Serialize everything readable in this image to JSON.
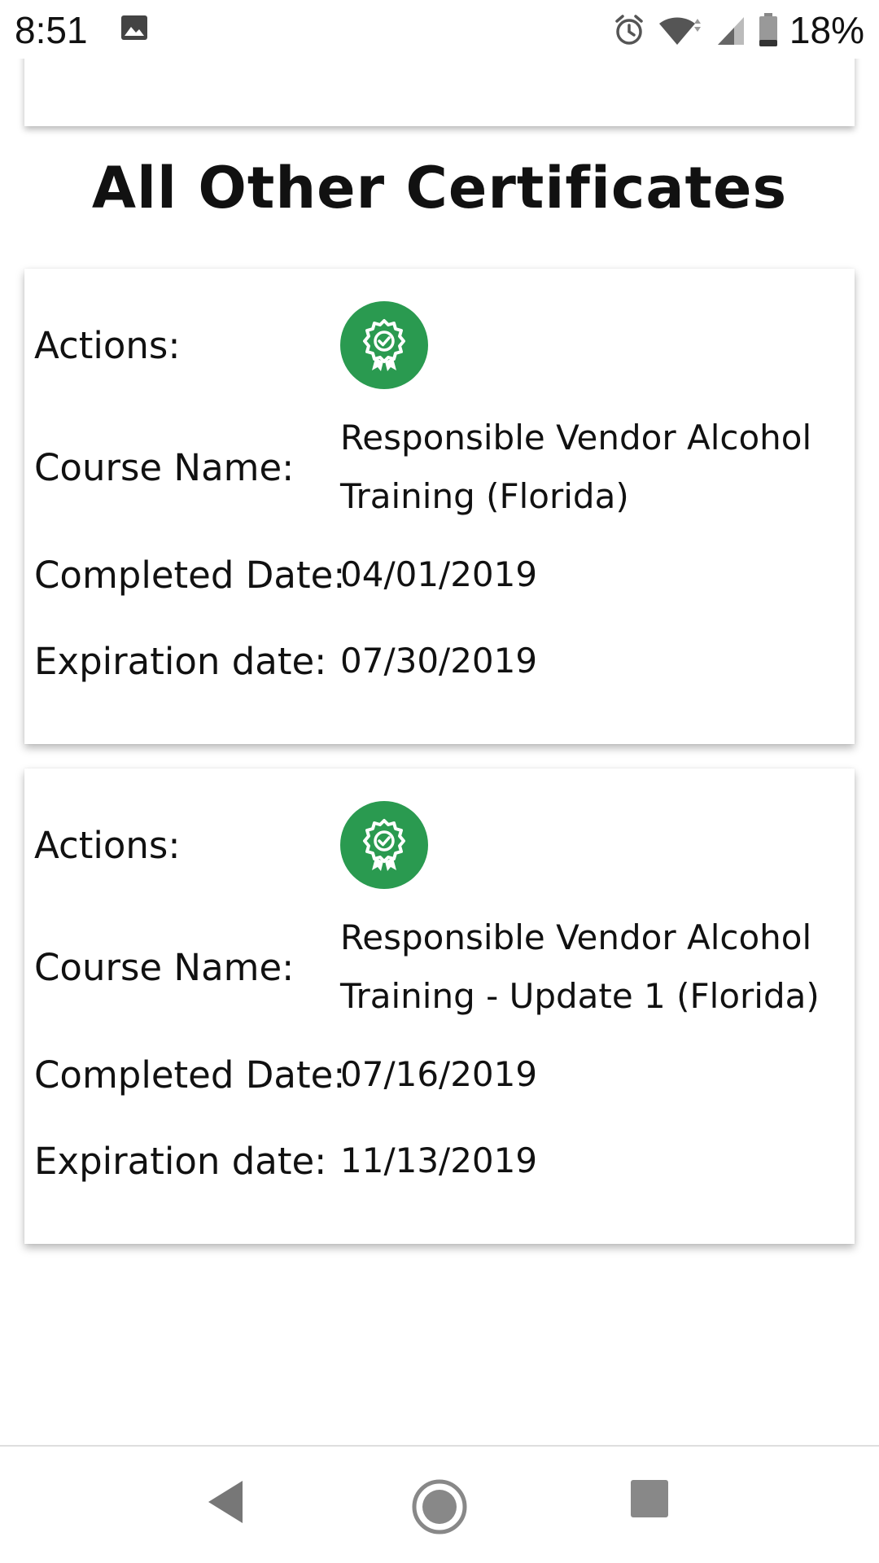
{
  "status_bar": {
    "time": "8:51",
    "left_icons": [
      "image-notification-icon"
    ],
    "right_icons": [
      "alarm-icon",
      "wifi-icon",
      "cellular-signal-icon",
      "battery-icon"
    ],
    "battery_percent": "18%"
  },
  "section": {
    "title": "All Other Certificates"
  },
  "labels": {
    "actions": "Actions:",
    "course_name": "Course Name:",
    "completed_date": "Completed Date:",
    "expiration_date": "Expiration date:"
  },
  "certificates": [
    {
      "action_icon": "certificate-badge-icon",
      "course_name_line1": "Responsible Vendor Alcohol",
      "course_name_line2": "Training (Florida)",
      "completed_date": "04/01/2019",
      "expiration_date": "07/30/2019"
    },
    {
      "action_icon": "certificate-badge-icon",
      "course_name_line1": "Responsible Vendor Alcohol",
      "course_name_line2": "Training - Update 1 (Florida)",
      "completed_date": "07/16/2019",
      "expiration_date": "11/13/2019"
    }
  ],
  "colors": {
    "action_button": "#2a9a50",
    "card_background": "#ffffff",
    "text": "#111111"
  },
  "nav_bar": {
    "buttons": [
      "back-icon",
      "home-icon",
      "recents-icon"
    ]
  }
}
